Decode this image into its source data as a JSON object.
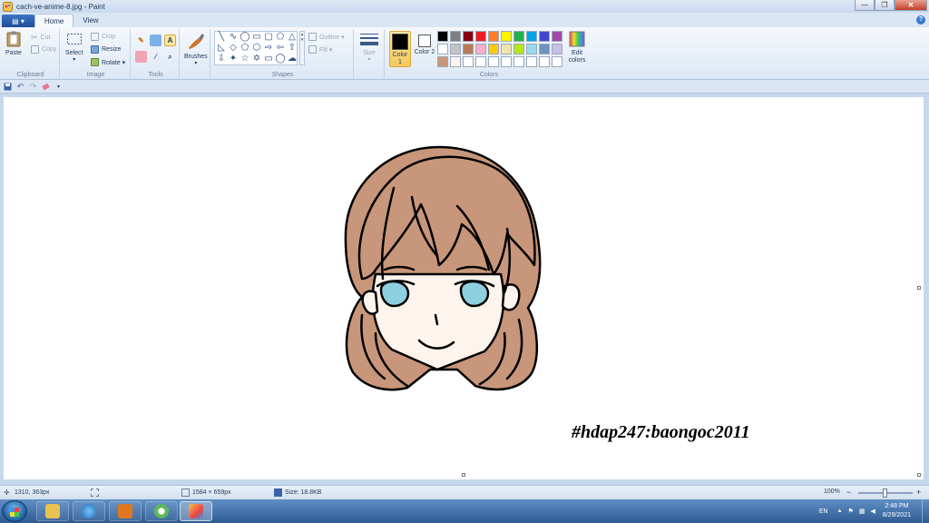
{
  "window": {
    "title": "cach-ve-anime-8.jpg - Paint",
    "minimize": "—",
    "maximize": "❐",
    "close": "✕"
  },
  "tabs": {
    "file": "▤ ▾",
    "home": "Home",
    "view": "View",
    "help": "?"
  },
  "ribbon": {
    "clipboard": {
      "label": "Clipboard",
      "paste": "Paste",
      "cut": "Cut",
      "copy": "Copy"
    },
    "image": {
      "label": "Image",
      "select": "Select",
      "crop": "Crop",
      "resize": "Resize",
      "rotate": "Rotate ▾"
    },
    "tools": {
      "label": "Tools",
      "text_glyph": "A"
    },
    "brushes": {
      "label": "Brushes"
    },
    "shapes": {
      "label": "Shapes",
      "outline": "Outline ▾",
      "fill": "Fill ▾"
    },
    "size": {
      "label": "Size"
    },
    "colors": {
      "label": "Colors",
      "color1": "Color 1",
      "color2": "Color 2",
      "edit": "Edit colors",
      "color1_value": "#000000",
      "color2_value": "#ffffff",
      "palette_row1": [
        "#000000",
        "#7f7f7f",
        "#880015",
        "#ed1c24",
        "#ff7f27",
        "#fff200",
        "#22b14c",
        "#00a2e8",
        "#3f48cc",
        "#a349a4"
      ],
      "palette_row2": [
        "#ffffff",
        "#c3c3c3",
        "#b97a57",
        "#ffaec9",
        "#ffc90e",
        "#efe4b0",
        "#b5e61d",
        "#99d9ea",
        "#7092be",
        "#c8bfe7"
      ],
      "palette_row3": [
        "#c8987a",
        "#fdf5ee",
        "#ffffff",
        "#ffffff",
        "#ffffff",
        "#ffffff",
        "#ffffff",
        "#ffffff",
        "#ffffff",
        "#ffffff"
      ]
    }
  },
  "canvas": {
    "caption": "#hdap247:baongoc2011",
    "hair_color": "#c8967a",
    "skin_color": "#fdf4ed",
    "eye_color": "#8ecfe0"
  },
  "status": {
    "cursor": "1310, 363px",
    "dimensions": "1584 × 659px",
    "size": "Size: 18.8KB",
    "zoom": "100%",
    "zoom_minus": "−",
    "zoom_plus": "+"
  },
  "taskbar": {
    "lang": "EN",
    "tray_arrow": "▲",
    "time": "2:48 PM",
    "date": "8/29/2021"
  }
}
